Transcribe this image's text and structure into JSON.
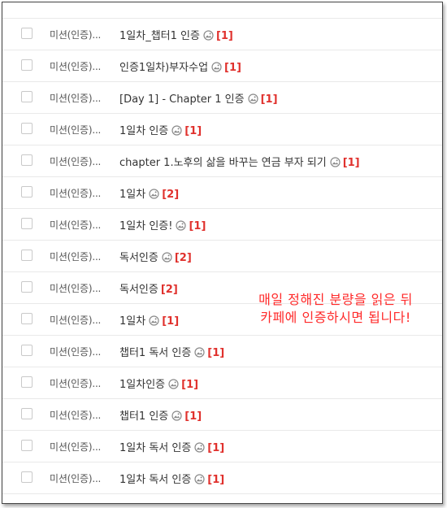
{
  "list": {
    "rows": [
      {
        "category": "미션(인증)...",
        "title": "1일차_챕터1 인증",
        "count": "[1]",
        "has_image": true
      },
      {
        "category": "미션(인증)...",
        "title": "인증1일차)부자수업",
        "count": "[1]",
        "has_image": true
      },
      {
        "category": "미션(인증)...",
        "title": "[Day 1] - Chapter 1 인증",
        "count": "[1]",
        "has_image": true
      },
      {
        "category": "미션(인증)...",
        "title": "1일차 인증",
        "count": "[1]",
        "has_image": true
      },
      {
        "category": "미션(인증)...",
        "title": "chapter 1.노후의 삶을 바꾸는 연금 부자 되기",
        "count": "[1]",
        "has_image": true
      },
      {
        "category": "미션(인증)...",
        "title": "1일차",
        "count": "[2]",
        "has_image": true
      },
      {
        "category": "미션(인증)...",
        "title": "1일차 인증!",
        "count": "[1]",
        "has_image": true
      },
      {
        "category": "미션(인증)...",
        "title": "독서인증",
        "count": "[2]",
        "has_image": true
      },
      {
        "category": "미션(인증)...",
        "title": "독서인증",
        "count": "[2]",
        "has_image": false
      },
      {
        "category": "미션(인증)...",
        "title": "1일차",
        "count": "[1]",
        "has_image": true
      },
      {
        "category": "미션(인증)...",
        "title": "챕터1 독서 인증",
        "count": "[1]",
        "has_image": true
      },
      {
        "category": "미션(인증)...",
        "title": "1일차인증",
        "count": "[1]",
        "has_image": true
      },
      {
        "category": "미션(인증)...",
        "title": "챕터1 인증",
        "count": "[1]",
        "has_image": true
      },
      {
        "category": "미션(인증)...",
        "title": "1일차 독서 인증",
        "count": "[1]",
        "has_image": true
      },
      {
        "category": "미션(인증)...",
        "title": "1일차 독서 인증",
        "count": "[1]",
        "has_image": true
      }
    ]
  },
  "overlay": {
    "line1": "매일 정해진 분량을 읽은 뒤",
    "line2": "카페에 인증하시면 됩니다!"
  },
  "colors": {
    "count_red": "#e0312d",
    "overlay_red": "#ff2a2a"
  },
  "icons": {
    "attachment": "image-attachment-icon"
  }
}
